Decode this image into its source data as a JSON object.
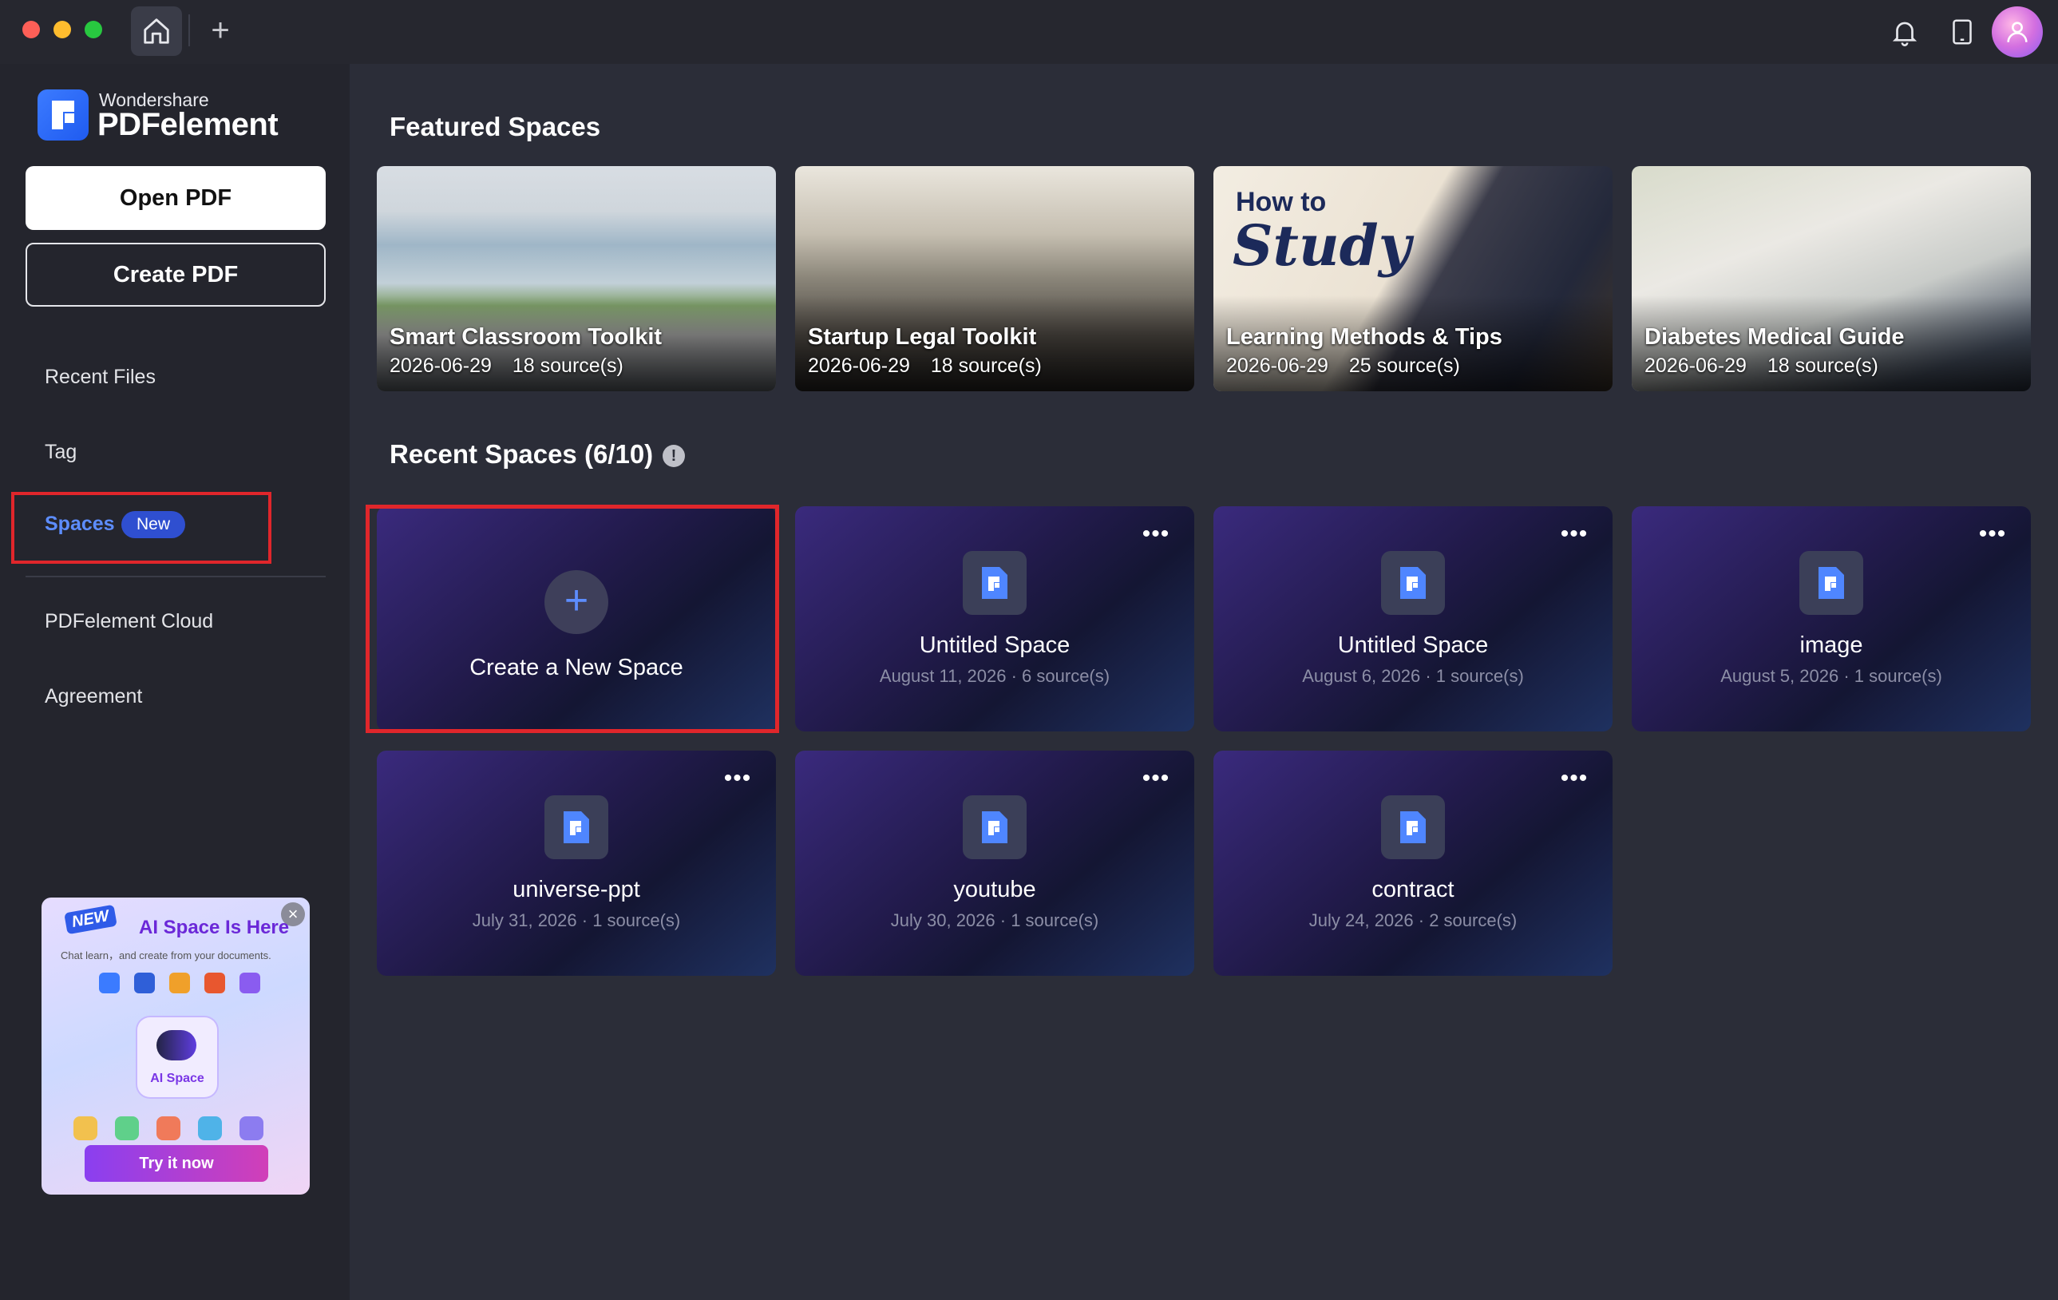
{
  "titlebar": {
    "home_icon": "home-icon",
    "new_tab_label": "+",
    "bell_icon": "bell-icon",
    "tablet_icon": "tablet-icon",
    "avatar_icon": "user-avatar"
  },
  "sidebar": {
    "brand_small": "Wondershare",
    "brand_big": "PDFelement",
    "open_pdf": "Open PDF",
    "create_pdf": "Create PDF",
    "nav": {
      "recent": "Recent Files",
      "tag": "Tag",
      "spaces": "Spaces",
      "spaces_badge": "New",
      "cloud": "PDFelement Cloud",
      "agreement": "Agreement"
    },
    "promo": {
      "new_tag": "NEW",
      "title": "AI Space Is Here",
      "subtitle": "Chat learn，and create from your documents.",
      "center_label": "AI Space",
      "button": "Try it now",
      "close": "×"
    }
  },
  "featured": {
    "title": "Featured Spaces",
    "items": [
      {
        "title": "Smart Classroom Toolkit",
        "date": "2026-06-29",
        "sources": "18 source(s)"
      },
      {
        "title": "Startup Legal Toolkit",
        "date": "2026-06-29",
        "sources": "18 source(s)"
      },
      {
        "title": "Learning Methods & Tips",
        "date": "2026-06-29",
        "sources": "25 source(s)",
        "image_text_1": "How to",
        "image_text_2": "Study"
      },
      {
        "title": "Diabetes Medical Guide",
        "date": "2026-06-29",
        "sources": "18 source(s)"
      }
    ]
  },
  "recent": {
    "title": "Recent Spaces (6/10)",
    "info_icon": "!",
    "create_label": "Create a New Space",
    "create_plus": "+",
    "more_label": "•••",
    "items": [
      {
        "name": "Untitled Space",
        "meta": "August 11, 2026 · 6 source(s)"
      },
      {
        "name": "Untitled Space",
        "meta": "August 6, 2026 · 1 source(s)"
      },
      {
        "name": "image",
        "meta": "August 5, 2026 · 1 source(s)"
      },
      {
        "name": "universe-ppt",
        "meta": "July 31, 2026 · 1 source(s)"
      },
      {
        "name": "youtube",
        "meta": "July 30, 2026 · 1 source(s)"
      },
      {
        "name": "contract",
        "meta": "July 24, 2026 · 2 source(s)"
      }
    ]
  },
  "colors": {
    "accent": "#5d8dff",
    "highlight": "#e0262b",
    "background": "#2b2d38",
    "sidebar": "#24252d"
  }
}
